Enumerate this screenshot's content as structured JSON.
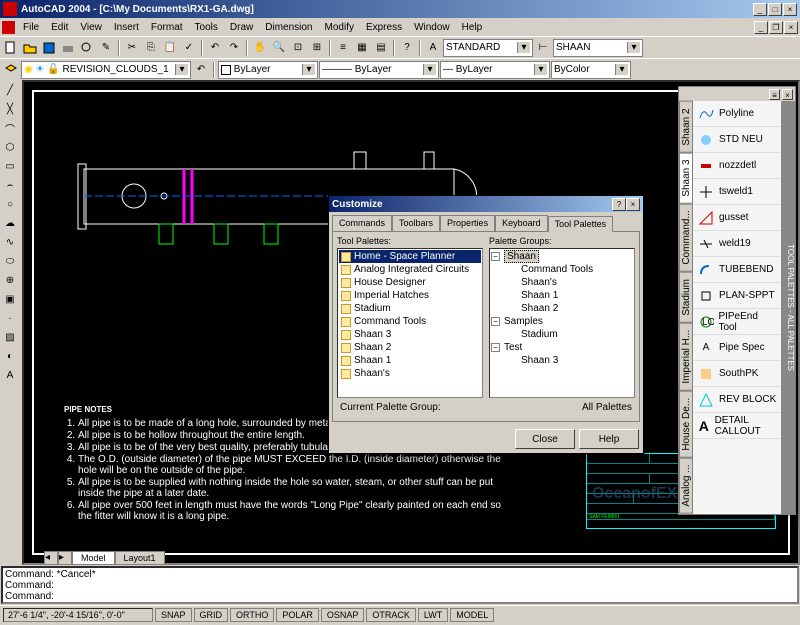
{
  "window": {
    "title": "AutoCAD 2004 - [C:\\My Documents\\RX1-GA.dwg]"
  },
  "menu": [
    "File",
    "Edit",
    "View",
    "Insert",
    "Format",
    "Tools",
    "Draw",
    "Dimension",
    "Modify",
    "Express",
    "Window",
    "Help"
  ],
  "toolbar2": {
    "layer_combo": "REVISION_CLOUDS_1",
    "style1": "STANDARD",
    "style2": "SHAAN"
  },
  "toolbar3": {
    "c1": "ByLayer",
    "c2": "ByLayer",
    "c3": "ByLayer",
    "c4": "ByColor"
  },
  "dialog": {
    "title": "Customize",
    "tabs": [
      "Commands",
      "Toolbars",
      "Properties",
      "Keyboard",
      "Tool Palettes"
    ],
    "left_label": "Tool Palettes:",
    "right_label": "Palette Groups:",
    "palettes": [
      "Home - Space Planner",
      "Analog Integrated Circuits",
      "House Designer",
      "Imperial Hatches",
      "Stadium",
      "Command Tools",
      "Shaan 3",
      "Shaan 2",
      "Shaan 1",
      "Shaan's"
    ],
    "tree": {
      "root1": "Shaan",
      "root1_items": [
        "Command Tools",
        "Shaan's",
        "Shaan 1",
        "Shaan 2"
      ],
      "root2": "Samples",
      "root2_items": [
        "Stadium"
      ],
      "root3": "Test",
      "root3_items": [
        "Shaan 3"
      ]
    },
    "current_label": "Current Palette Group:",
    "current_value": "All Palettes",
    "close": "Close",
    "help": "Help"
  },
  "palette": {
    "side_label": "TOOL PALETTES - ALL PALETTES",
    "tabs": [
      "Analog ...",
      "House De...",
      "Imperial H...",
      "Stadium",
      "Command...",
      "Shaan 3",
      "Shaan 2"
    ],
    "items": [
      {
        "icon": "polyline",
        "label": "Polyline"
      },
      {
        "icon": "stdneu",
        "label": "STD NEU"
      },
      {
        "icon": "nozz",
        "label": "nozzdetl"
      },
      {
        "icon": "weld",
        "label": "tsweld1"
      },
      {
        "icon": "gusset",
        "label": "gusset"
      },
      {
        "icon": "weld2",
        "label": "weld19"
      },
      {
        "icon": "tube",
        "label": "TUBEBEND"
      },
      {
        "icon": "plan",
        "label": "PLAN-SPPT"
      },
      {
        "icon": "pipe",
        "label": "PIPeEnd Tool"
      },
      {
        "icon": "spec",
        "label": "Pipe Spec"
      },
      {
        "icon": "south",
        "label": "SouthPK"
      },
      {
        "icon": "rev",
        "label": "REV BLOCK"
      },
      {
        "icon": "detail",
        "label": "DETAIL CALLOUT"
      }
    ]
  },
  "notes": {
    "heading": "PIPE NOTES",
    "items": [
      "All pipe is to be made of a long hole, surrounded by metal centered around the hole.",
      "All pipe is to be hollow throughout the entire length.",
      "All pipe is to be of the very best quality, preferably tubular or pipular.",
      "The O.D. (outside diameter) of the pipe MUST EXCEED the I.D. (inside diameter) otherwise the hole will be on the    outside of the pipe.",
      "All pipe is to be supplied with nothing inside the hole so water, steam, or other stuff can be put inside the pipe at a later date.",
      "All pipe over 500 feet in length must have the words \"Long Pipe\" clearly painted on each end so the fitter will know it is a long pipe."
    ]
  },
  "tabs_bottom": [
    "Model",
    "Layout1"
  ],
  "cmd": {
    "l1": "Command: *Cancel*",
    "l2": "Command:",
    "l3": "Command:"
  },
  "status": {
    "coord": "27'-6 1/4\", -20'-4 15/16\", 0'-0\"",
    "buttons": [
      "SNAP",
      "GRID",
      "ORTHO",
      "POLAR",
      "OSNAP",
      "OTRACK",
      "LWT",
      "MODEL"
    ]
  },
  "watermark": "OceanofEXE"
}
